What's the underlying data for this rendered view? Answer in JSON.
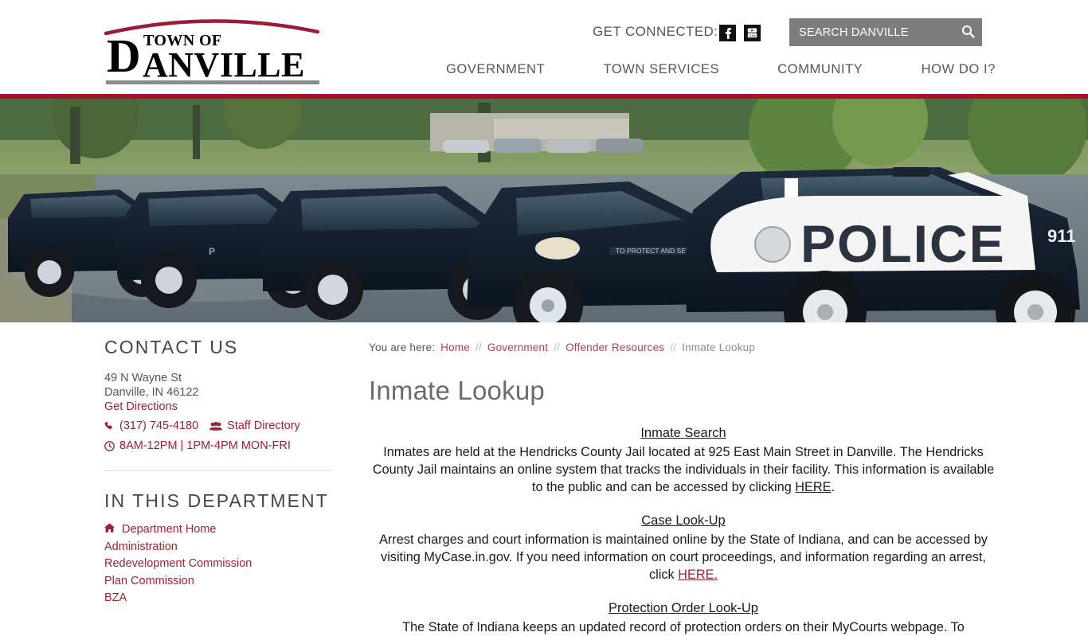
{
  "header": {
    "logo": {
      "cap_d": "D",
      "town_of": "TOWN OF",
      "anville": "ANVILLE",
      "alt": "Town of Danville"
    },
    "get_connected_label": "GET CONNECTED:",
    "social": [
      {
        "name": "facebook-icon",
        "label": "Facebook"
      },
      {
        "name": "youtube-icon",
        "label": "YouTube"
      }
    ],
    "search": {
      "placeholder": "SEARCH DANVILLE",
      "value": "",
      "button_label": "Search",
      "icon": "search-icon",
      "background": "#7d7d7d"
    },
    "nav": [
      {
        "label": "GOVERNMENT"
      },
      {
        "label": "TOWN SERVICES"
      },
      {
        "label": "COMMUNITY"
      },
      {
        "label": "HOW DO I?"
      }
    ]
  },
  "hero": {
    "alt": "Danville Police Department vehicles parked in a lot",
    "accent_bar_color": "#a4132b"
  },
  "sidebar": {
    "contact": {
      "heading": "CONTACT US",
      "address_line1": "49 N Wayne St",
      "address_line2": "Danville, IN 46122",
      "directions_label": "Get Directions",
      "phone": "(317) 745-4180",
      "staff_directory_label": "Staff Directory",
      "hours": "8AM-12PM | 1PM-4PM MON-FRI"
    },
    "department": {
      "heading": "IN THIS DEPARTMENT",
      "items": [
        {
          "label": "Department Home",
          "icon": "home-icon"
        },
        {
          "label": "Administration",
          "icon": ""
        },
        {
          "label": "Redevelopment Commission",
          "icon": ""
        },
        {
          "label": "Plan Commission",
          "icon": ""
        },
        {
          "label": "BZA",
          "icon": ""
        }
      ]
    }
  },
  "main": {
    "breadcrumb": {
      "label": "You are here:",
      "separator": "//",
      "items": [
        {
          "label": "Home",
          "current": false
        },
        {
          "label": "Government",
          "current": false
        },
        {
          "label": "Offender Resources",
          "current": false
        },
        {
          "label": "Inmate Lookup",
          "current": true
        }
      ]
    },
    "page_title": "Inmate Lookup",
    "sections": [
      {
        "heading": "Inmate Search",
        "body_before": "Inmates are held at the Hendricks County Jail located at 925 East Main Street in Danville. The Hendricks County Jail maintains an online system that tracks the individuals in their facility. This information is available to the public and can be accessed by clicking ",
        "link": "HERE",
        "link_style": "dark",
        "body_after": "."
      },
      {
        "heading": "Case Look-Up",
        "body_before": "Arrest charges and court information is maintained online by the State of Indiana, and can be accessed by visiting MyCase.in.gov. If you need information on court proceedings, and information regarding an arrest, click ",
        "link": "HERE.",
        "link_style": "red",
        "body_after": ""
      },
      {
        "heading": "Protection Order Look-Up",
        "body_before": "The State of Indiana keeps an updated record of protection orders on their MyCourts webpage. To",
        "link": "",
        "link_style": "none",
        "body_after": ""
      }
    ]
  },
  "theme": {
    "brand_red": "#9b2234",
    "accent_bar": "#a4132b",
    "nav_text": "#56565a",
    "heading_gray": "#44444c",
    "title_gray": "#6a6a70"
  }
}
